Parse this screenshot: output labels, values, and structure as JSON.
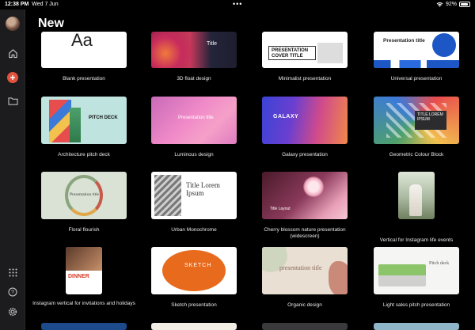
{
  "status": {
    "time": "12:38 PM",
    "date": "Wed 7 Jun",
    "dots": "•••",
    "battery": "92%",
    "battery_level": 0.92
  },
  "page": {
    "title": "New"
  },
  "templates": [
    {
      "name": "Blank presentation",
      "preview_text": "Aa"
    },
    {
      "name": "3D float design",
      "preview_text": "Title"
    },
    {
      "name": "Minimalist presentation",
      "preview_text": "PRESENTATION COVER TITLE"
    },
    {
      "name": "Universal presentation",
      "preview_text": "Presentation title"
    },
    {
      "name": "Architecture pitch deck",
      "preview_text": "PITCH DECK"
    },
    {
      "name": "Luminous design",
      "preview_text": "Presentation title"
    },
    {
      "name": "Galaxy presentation",
      "preview_text": "GALAXY"
    },
    {
      "name": "Geometric Colour Block",
      "preview_text": "TITLE LOREM IPSUM"
    },
    {
      "name": "Floral flourish",
      "preview_text": "Presentation title"
    },
    {
      "name": "Urban Monochrome",
      "preview_text": "Title Lorem Ipsum"
    },
    {
      "name": "Cherry blossom nature presentation (widescreen)",
      "preview_text": "Title Layout"
    },
    {
      "name": "Vertical for Instagram life events",
      "preview_text": ""
    },
    {
      "name": "Instagram vertical for invitations and holidays",
      "preview_text": "DINNER"
    },
    {
      "name": "Sketch presentation",
      "preview_text": "SKETCH"
    },
    {
      "name": "Organic design",
      "preview_text": "presentation title"
    },
    {
      "name": "Light sales pitch presentation",
      "preview_text": "Pitch deck"
    }
  ]
}
